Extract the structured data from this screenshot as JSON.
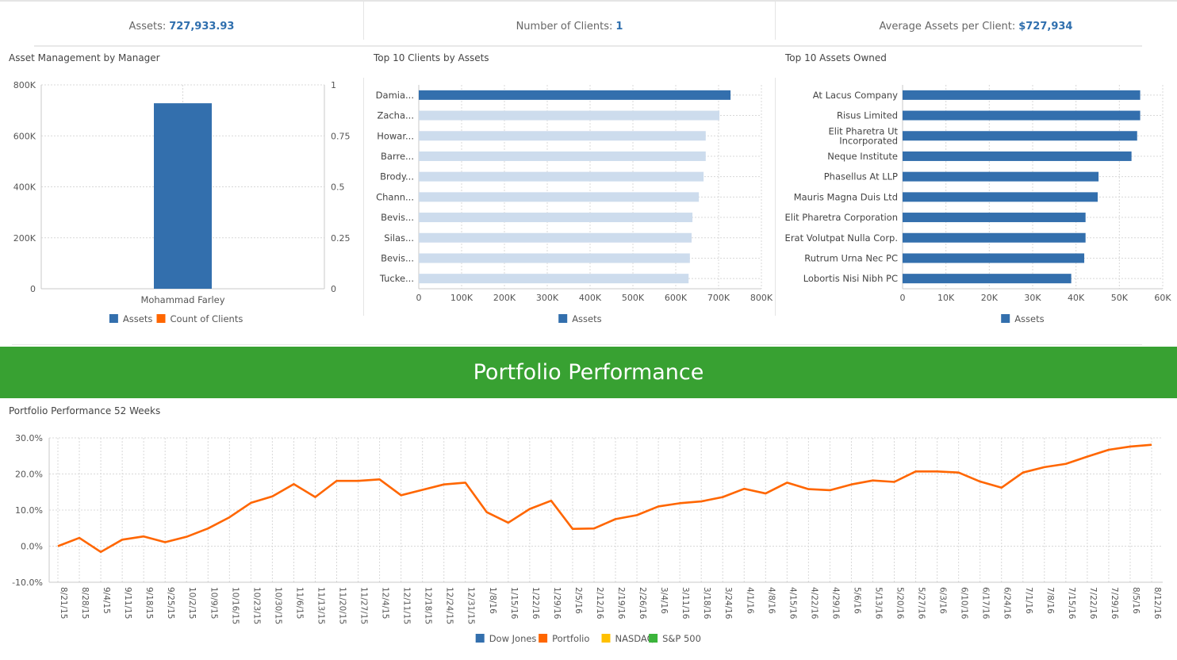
{
  "kpis": {
    "assets_label": "Assets:",
    "assets_value": "727,933.93",
    "clients_label": "Number of Clients:",
    "clients_value": "1",
    "avg_label": "Average Assets per Client:",
    "avg_value": "$727,934"
  },
  "banner": {
    "title": "Portfolio Performance"
  },
  "colors": {
    "primary": "#336fad",
    "faded": "#cddced",
    "orange": "#ff6600",
    "yellow": "#ffc000",
    "green": "#3bb43b",
    "banner": "#38a132",
    "kpi_value": "#2f6fae"
  },
  "chart_data": [
    {
      "id": "manager",
      "type": "bar",
      "title": "Asset Management by Manager",
      "categories": [
        "Mohammad Farley"
      ],
      "series": [
        {
          "name": "Assets",
          "values": [
            727934
          ],
          "color": "#336fad",
          "axis": "left"
        },
        {
          "name": "Count of Clients",
          "values": [
            0
          ],
          "color": "#ff6600",
          "axis": "right"
        }
      ],
      "ylim": [
        0,
        800000
      ],
      "yticks": [
        "0",
        "200K",
        "400K",
        "600K",
        "800K"
      ],
      "y2lim": [
        0,
        1
      ],
      "y2ticks": [
        "0",
        "0.25",
        "0.5",
        "0.75",
        "1"
      ],
      "legend": "bottom",
      "grid": true
    },
    {
      "id": "clients",
      "type": "bar",
      "orientation": "horizontal",
      "title": "Top 10 Clients by Assets",
      "categories": [
        "Damia...",
        "Zacha...",
        "Howar...",
        "Barre...",
        "Brody...",
        "Chann...",
        "Bevis...",
        "Silas...",
        "Bevis...",
        "Tucke..."
      ],
      "series": [
        {
          "name": "Assets",
          "values": [
            727934,
            702000,
            670000,
            670000,
            665000,
            654000,
            639000,
            637000,
            633000,
            630000
          ],
          "color": "#336fad"
        }
      ],
      "highlighted_index": 0,
      "xlim": [
        0,
        800000
      ],
      "xticks": [
        "0",
        "100K",
        "200K",
        "300K",
        "400K",
        "500K",
        "600K",
        "700K",
        "800K"
      ],
      "legend": "bottom",
      "grid": true
    },
    {
      "id": "assets_owned",
      "type": "bar",
      "orientation": "horizontal",
      "title": "Top 10 Assets Owned",
      "categories": [
        "At Lacus Company",
        "Risus Limited",
        "Elit Pharetra Ut Incorporated",
        "Neque Institute",
        "Phasellus At LLP",
        "Mauris Magna Duis Ltd",
        "Elit Pharetra Corporation",
        "Erat Volutpat Nulla Corp.",
        "Rutrum Urna Nec PC",
        "Lobortis Nisi Nibh PC"
      ],
      "category_lines": [
        [
          "At Lacus Company"
        ],
        [
          "Risus Limited"
        ],
        [
          "Elit Pharetra Ut",
          "Incorporated"
        ],
        [
          "Neque Institute"
        ],
        [
          "Phasellus At LLP"
        ],
        [
          "Mauris Magna Duis Ltd"
        ],
        [
          "Elit Pharetra Corporation"
        ],
        [
          "Erat Volutpat Nulla Corp."
        ],
        [
          "Rutrum Urna Nec PC"
        ],
        [
          "Lobortis Nisi Nibh PC"
        ]
      ],
      "series": [
        {
          "name": "Assets",
          "values": [
            54800,
            54800,
            54100,
            52800,
            45200,
            45000,
            42200,
            42200,
            41900,
            38900
          ],
          "color": "#336fad"
        }
      ],
      "xlim": [
        0,
        60000
      ],
      "xticks": [
        "0",
        "10K",
        "20K",
        "30K",
        "40K",
        "50K",
        "60K"
      ],
      "legend": "bottom",
      "grid": true
    },
    {
      "id": "performance",
      "type": "line",
      "title": "Portfolio Performance 52 Weeks",
      "x": [
        "8/21/15",
        "8/28/15",
        "9/4/15",
        "9/11/15",
        "9/18/15",
        "9/25/15",
        "10/2/15",
        "10/9/15",
        "10/16/15",
        "10/23/15",
        "10/30/15",
        "11/6/15",
        "11/13/15",
        "11/20/15",
        "11/27/15",
        "12/4/15",
        "12/11/15",
        "12/18/15",
        "12/24/15",
        "12/31/15",
        "1/8/16",
        "1/15/16",
        "1/22/16",
        "1/29/16",
        "2/5/16",
        "2/12/16",
        "2/19/16",
        "2/26/16",
        "3/4/16",
        "3/11/16",
        "3/18/16",
        "3/24/16",
        "4/1/16",
        "4/8/16",
        "4/15/16",
        "4/22/16",
        "4/29/16",
        "5/6/16",
        "5/13/16",
        "5/20/16",
        "5/27/16",
        "6/3/16",
        "6/10/16",
        "6/17/16",
        "6/24/16",
        "7/1/16",
        "7/8/16",
        "7/15/16",
        "7/22/16",
        "7/29/16",
        "8/5/16",
        "8/12/16"
      ],
      "series": [
        {
          "name": "Dow Jones",
          "values": [],
          "color": "#336fad"
        },
        {
          "name": "Portfolio",
          "values": [
            0.0,
            2.3,
            -1.6,
            1.8,
            2.7,
            1.1,
            2.6,
            4.9,
            8.0,
            12.0,
            13.8,
            17.2,
            13.6,
            18.1,
            18.1,
            18.5,
            14.1,
            15.6,
            17.1,
            17.6,
            9.4,
            6.5,
            10.3,
            12.6,
            4.8,
            4.9,
            7.5,
            8.6,
            11.0,
            11.9,
            12.4,
            13.6,
            15.9,
            14.6,
            17.6,
            15.8,
            15.5,
            17.1,
            18.2,
            17.8,
            20.7,
            20.7,
            20.4,
            17.9,
            16.2,
            20.4,
            21.9,
            22.8,
            24.8,
            26.7,
            27.6,
            28.1
          ],
          "color": "#ff6600"
        },
        {
          "name": "NASDAQ",
          "values": [],
          "color": "#ffc000"
        },
        {
          "name": "S&P 500",
          "values": [],
          "color": "#3bb43b"
        }
      ],
      "ylim": [
        -10,
        30
      ],
      "yticks": [
        "-10.0%",
        "0.0%",
        "10.0%",
        "20.0%",
        "30.0%"
      ],
      "xlabel": "",
      "ylabel": "",
      "legend": "bottom",
      "grid": true
    }
  ]
}
